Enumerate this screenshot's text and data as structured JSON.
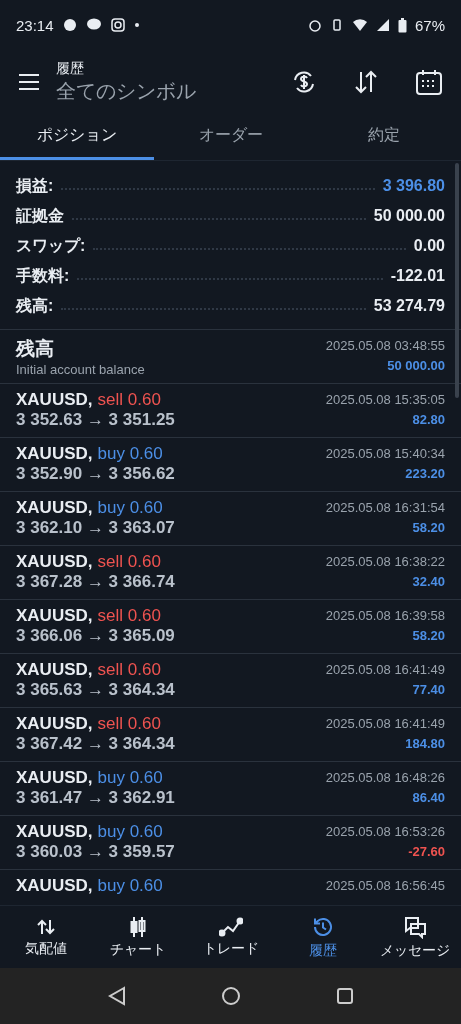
{
  "status_bar": {
    "time": "23:14",
    "battery": "67%"
  },
  "header": {
    "title": "履歴",
    "subtitle": "全てのシンボル"
  },
  "tabs": [
    {
      "label": "ポジション",
      "selected": true
    },
    {
      "label": "オーダー",
      "selected": false
    },
    {
      "label": "約定",
      "selected": false
    }
  ],
  "summary": [
    {
      "label": "損益:",
      "value": "3 396.80",
      "highlight": true
    },
    {
      "label": "証拠金",
      "value": "50 000.00",
      "highlight": false
    },
    {
      "label": "スワップ:",
      "value": "0.00",
      "highlight": false
    },
    {
      "label": "手数料:",
      "value": "-122.01",
      "highlight": false
    },
    {
      "label": "残高:",
      "value": "53 274.79",
      "highlight": false
    }
  ],
  "balance": {
    "title": "残高",
    "comment": "Initial account balance",
    "time": "2025.05.08 03:48:55",
    "amount": "50 000.00"
  },
  "deals": [
    {
      "symbol": "XAUUSD,",
      "kind": "sell",
      "side": "sell 0.60",
      "prices": "3 352.63 → 3 351.25",
      "time": "2025.05.08 15:35:05",
      "profit": "82.80",
      "loss": false
    },
    {
      "symbol": "XAUUSD,",
      "kind": "buy",
      "side": "buy 0.60",
      "prices": "3 352.90 → 3 356.62",
      "time": "2025.05.08 15:40:34",
      "profit": "223.20",
      "loss": false
    },
    {
      "symbol": "XAUUSD,",
      "kind": "buy",
      "side": "buy 0.60",
      "prices": "3 362.10 → 3 363.07",
      "time": "2025.05.08 16:31:54",
      "profit": "58.20",
      "loss": false
    },
    {
      "symbol": "XAUUSD,",
      "kind": "sell",
      "side": "sell 0.60",
      "prices": "3 367.28 → 3 366.74",
      "time": "2025.05.08 16:38:22",
      "profit": "32.40",
      "loss": false
    },
    {
      "symbol": "XAUUSD,",
      "kind": "sell",
      "side": "sell 0.60",
      "prices": "3 366.06 → 3 365.09",
      "time": "2025.05.08 16:39:58",
      "profit": "58.20",
      "loss": false
    },
    {
      "symbol": "XAUUSD,",
      "kind": "sell",
      "side": "sell 0.60",
      "prices": "3 365.63 → 3 364.34",
      "time": "2025.05.08 16:41:49",
      "profit": "77.40",
      "loss": false
    },
    {
      "symbol": "XAUUSD,",
      "kind": "sell",
      "side": "sell 0.60",
      "prices": "3 367.42 → 3 364.34",
      "time": "2025.05.08 16:41:49",
      "profit": "184.80",
      "loss": false
    },
    {
      "symbol": "XAUUSD,",
      "kind": "buy",
      "side": "buy 0.60",
      "prices": "3 361.47 → 3 362.91",
      "time": "2025.05.08 16:48:26",
      "profit": "86.40",
      "loss": false
    },
    {
      "symbol": "XAUUSD,",
      "kind": "buy",
      "side": "buy 0.60",
      "prices": "3 360.03 → 3 359.57",
      "time": "2025.05.08 16:53:26",
      "profit": "-27.60",
      "loss": true
    },
    {
      "symbol": "XAUUSD,",
      "kind": "buy",
      "side": "buy 0.60",
      "time": "2025.05.08 16:56:45"
    }
  ],
  "bottom_nav": [
    {
      "kind": "quotes",
      "label": "気配値",
      "selected": false
    },
    {
      "kind": "chart",
      "label": "チャート",
      "selected": false
    },
    {
      "kind": "trade",
      "label": "トレード",
      "selected": false
    },
    {
      "kind": "history",
      "label": "履歴",
      "selected": true
    },
    {
      "kind": "messages",
      "label": "メッセージ",
      "selected": false
    }
  ]
}
